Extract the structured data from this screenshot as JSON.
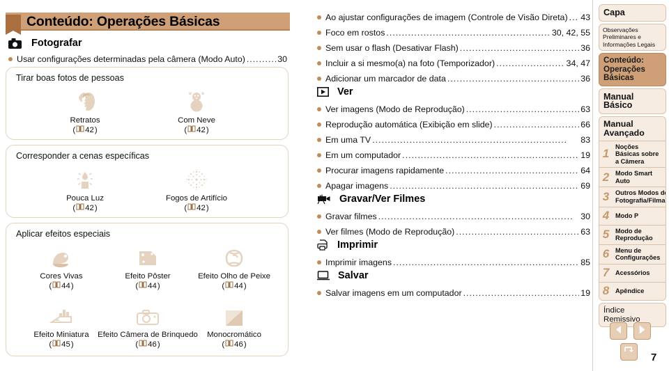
{
  "header": {
    "title": "Conteúdo: Operações Básicas",
    "tab_icon": "bookmark-icon"
  },
  "left": {
    "shoot_section": {
      "icon": "camera-icon",
      "label": "Fotografar",
      "entry": {
        "text": "Usar configurações determinadas pela câmera (Modo Auto)",
        "page": "30"
      }
    },
    "panels": [
      {
        "title": "Tirar boas fotos de pessoas",
        "tiles": [
          {
            "icon": "portrait-icon",
            "label": "Retratos",
            "ref": "42"
          },
          {
            "icon": "snowman-icon",
            "label": "Com Neve",
            "ref": "42"
          }
        ]
      },
      {
        "title": "Corresponder a cenas específicas",
        "tiles": [
          {
            "icon": "lowlight-candle-icon",
            "label": "Pouca Luz",
            "ref": "42"
          },
          {
            "icon": "fireworks-icon",
            "label": "Fogos de Artifício",
            "ref": "42"
          }
        ]
      },
      {
        "title": "Aplicar efeitos especiais",
        "tiles": [
          {
            "icon": "vivid-colors-icon",
            "label": "Cores Vivas",
            "ref": "44"
          },
          {
            "icon": "poster-effect-icon",
            "label": "Efeito Pôster",
            "ref": "44"
          },
          {
            "icon": "fisheye-effect-icon",
            "label": "Efeito Olho de Peixe",
            "ref": "44"
          },
          {
            "icon": "miniature-effect-icon",
            "label": "Efeito Miniatura",
            "ref": "45"
          },
          {
            "icon": "toy-camera-icon",
            "label": "Efeito Câmera de Brinquedo",
            "ref": "46"
          },
          {
            "icon": "monochrome-icon",
            "label": "Monocromático",
            "ref": "46"
          }
        ]
      }
    ]
  },
  "middle": {
    "blocks": [
      {
        "entries": [
          {
            "text": "Ao ajustar configurações de imagem (Controle de Visão Direta)",
            "page": "43"
          },
          {
            "text": "Foco em rostos",
            "page": "30, 42, 55"
          },
          {
            "text": "Sem usar o flash (Desativar Flash)",
            "page": "36"
          },
          {
            "text": "Incluir a si mesmo(a) na foto (Temporizador)",
            "page": "34, 47"
          },
          {
            "text": "Adicionar um marcador de data",
            "page": "36"
          }
        ]
      },
      {
        "heading": {
          "icon": "play-box-icon",
          "label": "Ver"
        },
        "entries": [
          {
            "text": "Ver imagens (Modo de Reprodução)",
            "page": "63"
          },
          {
            "text": "Reprodução automática (Exibição em slide)",
            "page": "66"
          },
          {
            "text": "Em uma TV",
            "page": "83"
          },
          {
            "text": "Em um computador",
            "page": "19"
          },
          {
            "text": "Procurar imagens rapidamente",
            "page": "64"
          },
          {
            "text": "Apagar imagens",
            "page": "69"
          }
        ]
      },
      {
        "heading": {
          "icon": "movie-camera-icon",
          "label": "Gravar/Ver Filmes"
        },
        "entries": [
          {
            "text": "Gravar filmes",
            "page": "30"
          },
          {
            "text": "Ver filmes (Modo de Reprodução)",
            "page": "63"
          }
        ]
      },
      {
        "heading": {
          "icon": "printer-icon",
          "label": "Imprimir"
        },
        "entries": [
          {
            "text": "Imprimir imagens",
            "page": "85"
          }
        ]
      },
      {
        "heading": {
          "icon": "monitor-icon",
          "label": "Salvar"
        },
        "entries": [
          {
            "text": "Salvar imagens em um computador",
            "page": "19"
          }
        ]
      }
    ]
  },
  "sidebar": {
    "items": [
      {
        "label": "Capa",
        "style": "big"
      },
      {
        "label": "Observações Preliminares e Informações Legais",
        "style": "small"
      },
      {
        "label": "Conteúdo: Operações Básicas",
        "style": "active"
      },
      {
        "label": "Manual Básico",
        "style": "big"
      }
    ],
    "advanced_heading": "Manual Avançado",
    "chapters": [
      {
        "num": "1",
        "label": "Noções Básicas sobre a Câmera"
      },
      {
        "num": "2",
        "label": "Modo Smart Auto"
      },
      {
        "num": "3",
        "label": "Outros Modos de Fotografia/Filmagem"
      },
      {
        "num": "4",
        "label": "Modo P"
      },
      {
        "num": "5",
        "label": "Modo de Reprodução"
      },
      {
        "num": "6",
        "label": "Menu de Configurações"
      },
      {
        "num": "7",
        "label": "Acessórios"
      },
      {
        "num": "8",
        "label": "Apêndice"
      }
    ],
    "index_label": "Índice Remissivo"
  },
  "footer": {
    "prev_icon": "arrow-left-icon",
    "next_icon": "arrow-right-icon",
    "back_icon": "return-arrow-icon",
    "page_number": "7"
  },
  "colors": {
    "accent": "#cfa077",
    "accent_dark": "#a96f3f",
    "panel_border": "#e3d4c2",
    "nav_bg": "#f6ece2",
    "icon_tan": "#e6d3bf",
    "bullet": "#c08c5c"
  }
}
